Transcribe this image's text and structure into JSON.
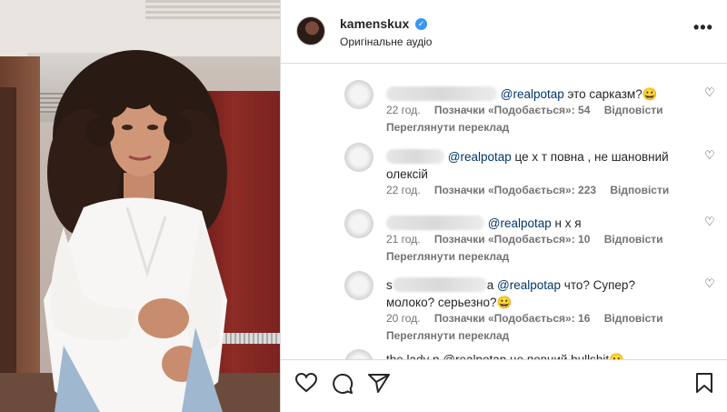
{
  "post": {
    "username": "kamenskux",
    "audio_label": "Оригінальне аудіо",
    "more_label": "•••"
  },
  "comments": [
    {
      "mention": "@realpotap",
      "text_after": " это сарказм?😀",
      "time": "22 год.",
      "likes": "Позначки «Подобається»: 54",
      "reply": "Відповісти",
      "translate": "Переглянути переклад"
    },
    {
      "mention": "@realpotap",
      "text_after": " це х    т  повна , не шановний олексій",
      "time": "22 год.",
      "likes": "Позначки «Подобається»: 223",
      "reply": "Відповісти",
      "translate": ""
    },
    {
      "mention": "@realpotap",
      "text_after": " н х я",
      "time": "21 год.",
      "likes": "Позначки «Подобається»: 10",
      "reply": "Відповісти",
      "translate": "Переглянути переклад"
    },
    {
      "prefix": "s",
      "mid": "а",
      "mention": "@realpotap",
      "text_after": " что? Супер? молоко? серьезно?😀",
      "time": "20 год.",
      "likes": "Позначки «Подобається»: 16",
      "reply": "Відповісти",
      "translate": "Переглянути переклад"
    },
    {
      "partial_text": "the lady n @realpotap це повний bullshit😐"
    }
  ],
  "icons": {
    "verified": "verified-badge-icon",
    "like": "heart-icon",
    "comment": "comment-bubble-icon",
    "share": "paper-plane-icon",
    "save": "bookmark-icon",
    "more": "more-options-icon"
  },
  "colors": {
    "mention": "#00376b",
    "verified": "#3897f0",
    "meta": "#737373",
    "text": "#262626"
  }
}
